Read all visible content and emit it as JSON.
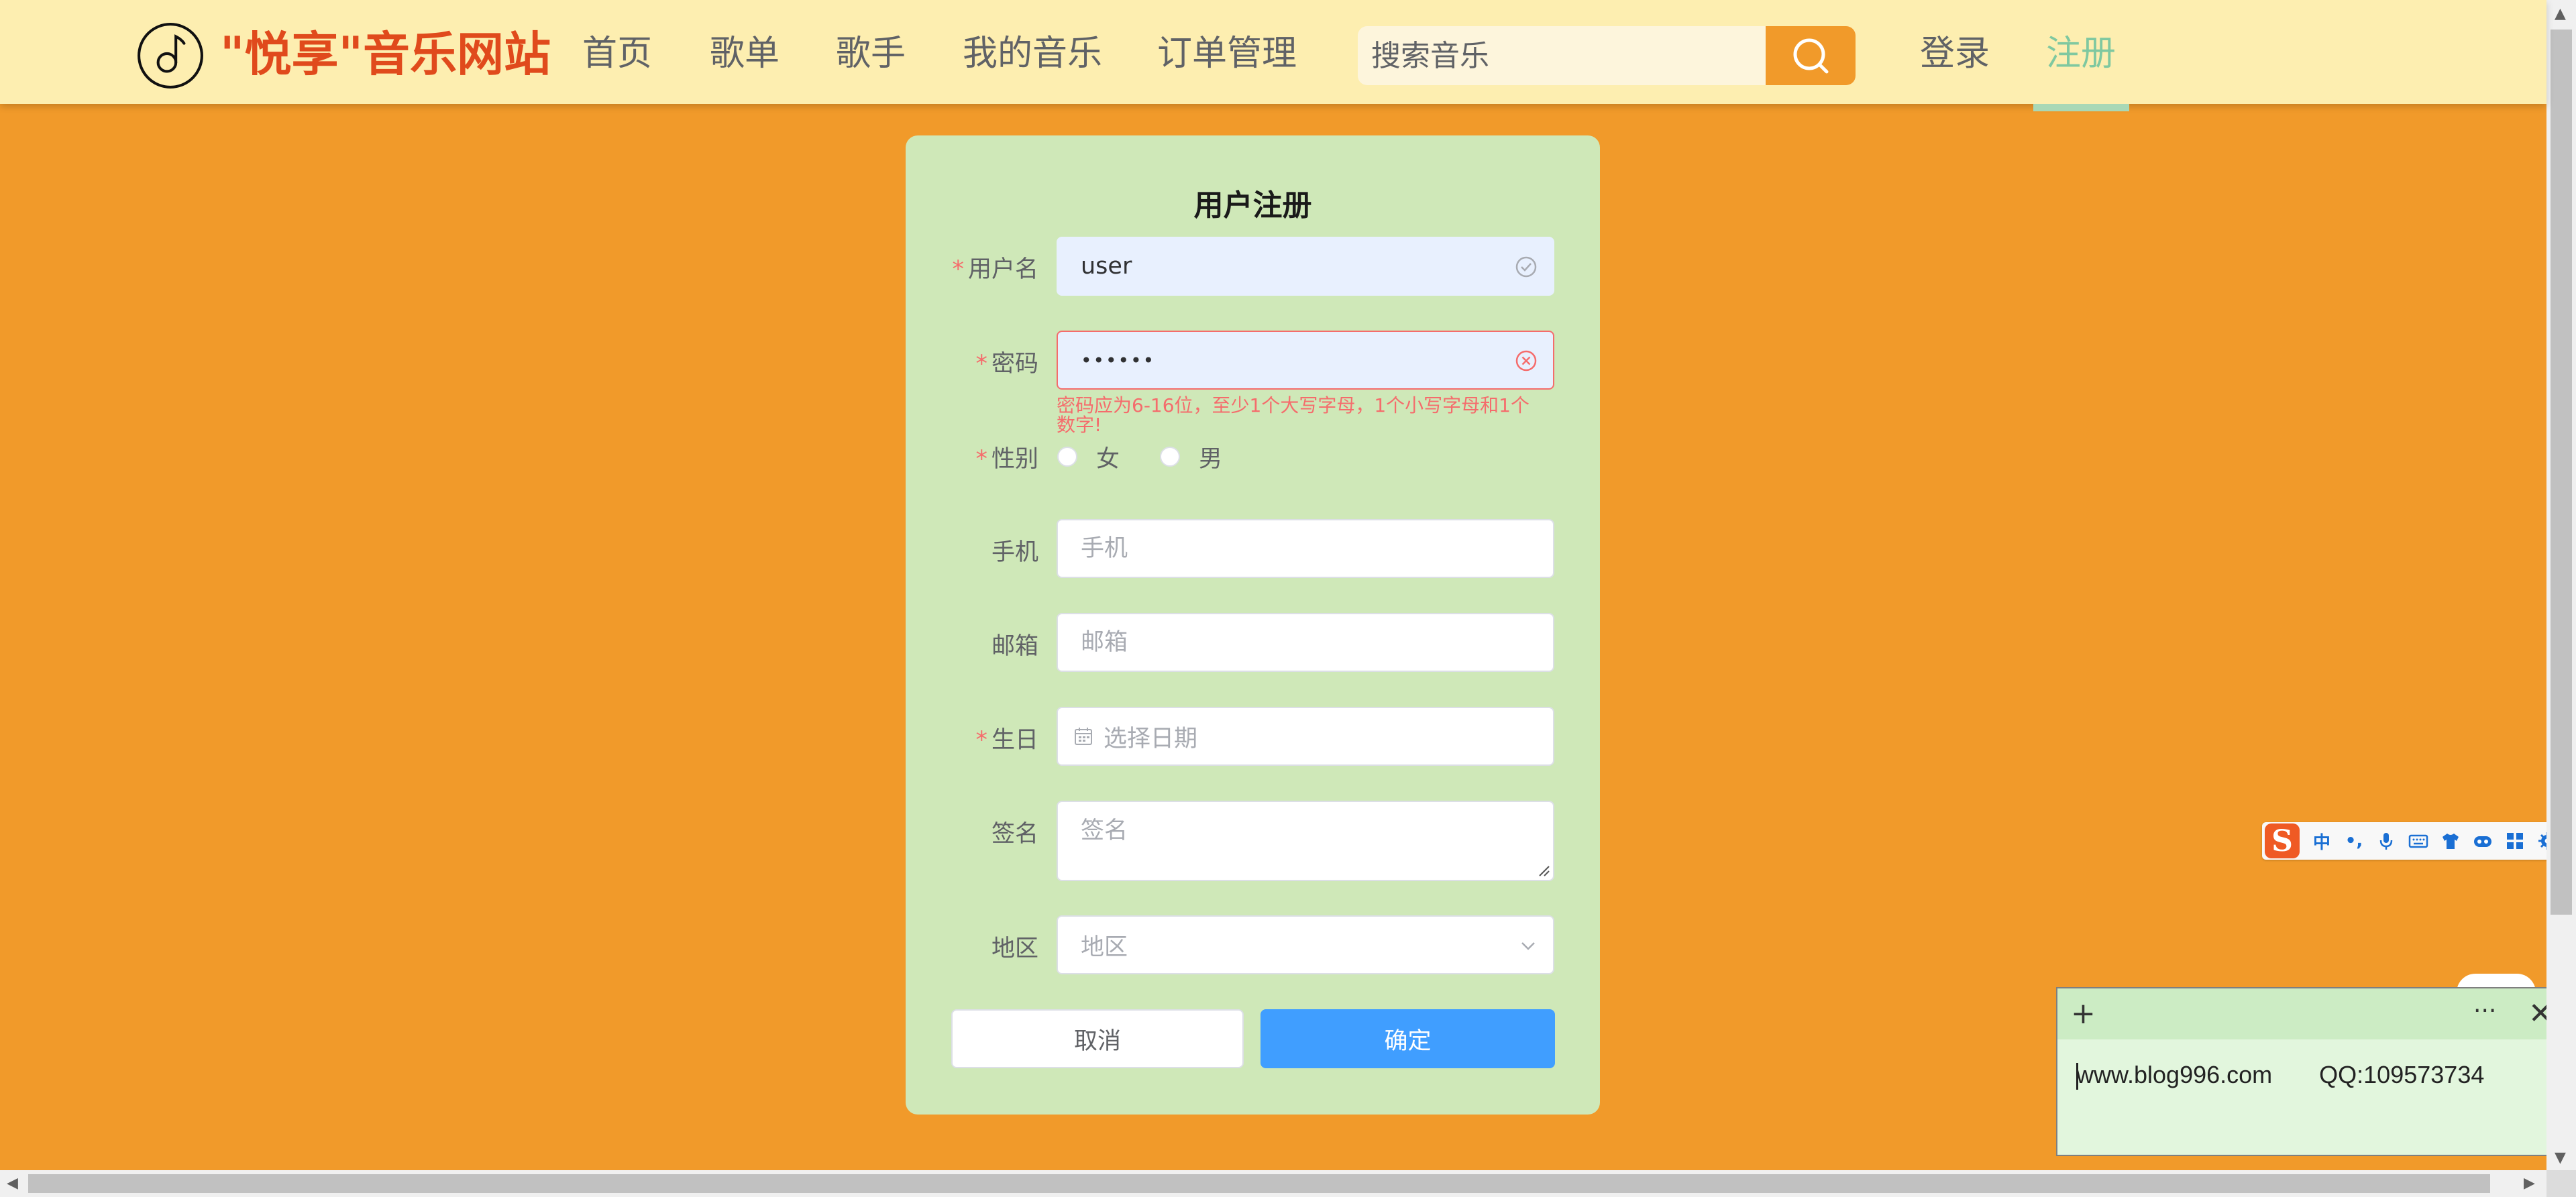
{
  "header": {
    "logo_text": "\"悦享\"音乐网站",
    "nav": [
      "首页",
      "歌单",
      "歌手",
      "我的音乐",
      "订单管理"
    ],
    "search_placeholder": "搜索音乐",
    "login": "登录",
    "register": "注册",
    "colors": {
      "background": "#fdeeb0",
      "logo": "#e04a1c",
      "active": "#7fc8a0",
      "accent": "#f19a2a"
    }
  },
  "form": {
    "title": "用户注册",
    "required_mark": "*",
    "username": {
      "label": "用户名",
      "value": "user"
    },
    "password": {
      "label": "密码",
      "value": "••••••",
      "error": "密码应为6-16位，至少1个大写字母，1个小写字母和1个数字!"
    },
    "gender": {
      "label": "性别",
      "options": [
        "女",
        "男"
      ]
    },
    "phone": {
      "label": "手机",
      "placeholder": "手机"
    },
    "email": {
      "label": "邮箱",
      "placeholder": "邮箱"
    },
    "birthday": {
      "label": "生日",
      "placeholder": "选择日期"
    },
    "signature": {
      "label": "签名",
      "placeholder": "签名"
    },
    "region": {
      "label": "地区",
      "placeholder": "地区"
    },
    "cancel": "取消",
    "confirm": "确定",
    "colors": {
      "card": "#cfe8b8",
      "error": "#f56c6c",
      "primary": "#409eff"
    }
  },
  "ime": {
    "logo": "S",
    "icons": [
      "中",
      "•,",
      "mic-icon",
      "keyboard-icon",
      "shirt-icon",
      "gamepad-icon",
      "grid-icon",
      "settings-icon"
    ]
  },
  "note": {
    "text": "www.blog996.com",
    "qq": "QQ:109573734"
  }
}
